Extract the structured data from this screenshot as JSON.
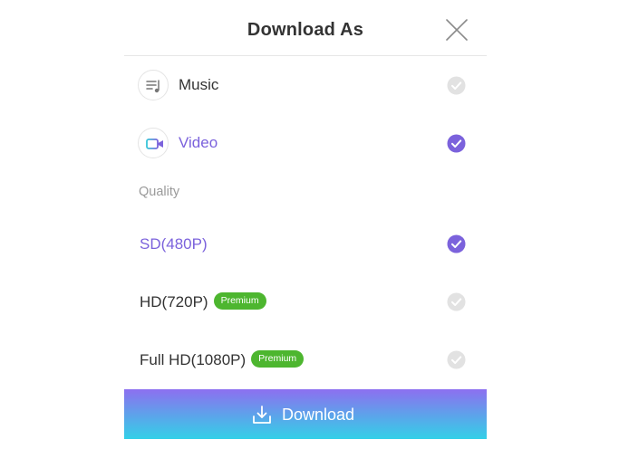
{
  "dialog": {
    "title": "Download As"
  },
  "formats": [
    {
      "label": "Music",
      "icon": "music-playlist-icon",
      "selected": false
    },
    {
      "label": "Video",
      "icon": "video-camera-icon",
      "selected": true
    }
  ],
  "quality": {
    "section_label": "Quality",
    "options": [
      {
        "label": "SD(480P)",
        "badge": "",
        "selected": true
      },
      {
        "label": "HD(720P)",
        "badge": "Premium",
        "selected": false
      },
      {
        "label": "Full HD(1080P)",
        "badge": "Premium",
        "selected": false
      }
    ]
  },
  "download_button": {
    "label": "Download",
    "icon": "download-icon"
  },
  "colors": {
    "accent": "#7b62dc",
    "premium_badge": "#4db62f",
    "unselected_check": "#e2e2e2",
    "gradient_start": "#8d6ff0",
    "gradient_end": "#33d0e8"
  }
}
